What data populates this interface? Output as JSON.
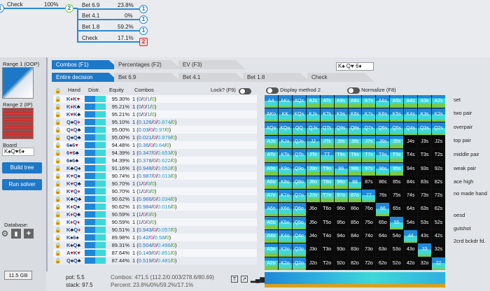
{
  "tree": {
    "root_node": "1",
    "check_label": "Check",
    "check_pct": "100%",
    "mid_node": "2",
    "actions": [
      {
        "label": "Bet 6.9",
        "pct": "23.8%",
        "node": "1"
      },
      {
        "label": "Bet 4.1",
        "pct": "0%",
        "node": "1"
      },
      {
        "label": "Bet 1.8",
        "pct": "59.2%",
        "node": "1"
      },
      {
        "label": "Check",
        "pct": "17.1%",
        "node": "2"
      }
    ]
  },
  "sidebar": {
    "range1": "Range 1 (OOP)",
    "range2": "Range 2 (IP)",
    "board_label": "Board",
    "board_cards": "K♠Q♥6♦",
    "build_tree": "Build tree",
    "run_solver": "Run solver",
    "database": "Database:",
    "memory": "11.5 GB"
  },
  "tabs": {
    "combos": "Combos (F1)",
    "percentages": "Percentages (F2)",
    "ev": "EV (F3)",
    "board_display": "K♠ Q♥ 6♦",
    "entire": "Entire decision",
    "bet69": "Bet 6.9",
    "bet41": "Bet 4.1",
    "bet18": "Bet 1.8",
    "check": "Check"
  },
  "table_header": {
    "hand": "Hand",
    "distr": "Distr.",
    "equity": "Equity",
    "combos": "Combos",
    "lock": "Lock? (F9)"
  },
  "rows": [
    {
      "hand": "K♦K♥",
      "equity": "95.30%",
      "combos": "1 (0/0/1/0)"
    },
    {
      "hand": "K♦K♣",
      "equity": "95.21%",
      "combos": "1 (0/0/1/0)"
    },
    {
      "hand": "K♥K♣",
      "equity": "95.21%",
      "combos": "1 (0/0/1/0)"
    },
    {
      "hand": "Q♠Q♦",
      "equity": "95.10%",
      "combos": "1 (0.126/0/0.874/0)"
    },
    {
      "hand": "Q♦Q♣",
      "equity": "95.00%",
      "combos": "1 (0.03/0/0.97/0)"
    },
    {
      "hand": "Q♠Q♣",
      "equity": "95.00%",
      "combos": "1 (0.021/0/0.979/0)"
    },
    {
      "hand": "6♠6♥",
      "equity": "94.48%",
      "combos": "1 (0.36/0/0.64/0)"
    },
    {
      "hand": "6♥6♣",
      "equity": "94.39%",
      "combos": "1 (0.347/0/0.653/0)"
    },
    {
      "hand": "6♠6♣",
      "equity": "94.39%",
      "combos": "1 (0.378/0/0.622/0)"
    },
    {
      "hand": "K♣Q♠",
      "equity": "91.16%",
      "combos": "1 (0.948/0/0.052/0)"
    },
    {
      "hand": "K♥Q♠",
      "equity": "90.74%",
      "combos": "1 (0.987/0/0.013/0)"
    },
    {
      "hand": "K♥Q♣",
      "equity": "90.70%",
      "combos": "1 (1/0/0/0)"
    },
    {
      "hand": "K♥Q♦",
      "equity": "90.70%",
      "combos": "1 (1/0/0/0)"
    },
    {
      "hand": "K♣Q♣",
      "equity": "90.62%",
      "combos": "1 (0.966/0/0.034/0)"
    },
    {
      "hand": "K♦Q♠",
      "equity": "90.62%",
      "combos": "1 (0.984/0/0.016/0)"
    },
    {
      "hand": "K♦Q♣",
      "equity": "90.59%",
      "combos": "1 (1/0/0/0)"
    },
    {
      "hand": "K♦Q♦",
      "equity": "90.59%",
      "combos": "1 (1/0/0/0)"
    },
    {
      "hand": "K♣Q♦",
      "equity": "90.51%",
      "combos": "1 (0.943/0/0.057/0)"
    },
    {
      "hand": "K♠6♠",
      "equity": "89.98%",
      "combos": "1 (0.42/0/0.58/0)"
    },
    {
      "hand": "K♠Q♣",
      "equity": "89.31%",
      "combos": "1 (0.504/0/0.496/0)"
    },
    {
      "hand": "A♥K♥",
      "equity": "87.64%",
      "combos": "1 (0.149/0/0.851/0)"
    },
    {
      "hand": "Q♠Q♣",
      "equity": "87.44%",
      "combos": "1 (0.519/0/0.481/0)"
    }
  ],
  "footer": {
    "pot": "pot: 5.5",
    "stack": "stack: 97.5",
    "combos": "Combos: 471.5 (112.2/0.003/278.6/80.69)",
    "percent": "Percent: 23.8%/0%/59.2%/17.1%"
  },
  "grid_controls": {
    "display_method": "Display method 2",
    "normalize": "Normalize (F8)"
  },
  "grid_labels": [
    [
      "AA",
      "AKs",
      "AQs",
      "AJs",
      "ATs",
      "A9s",
      "A8s",
      "A7s",
      "A6s",
      "A5s",
      "A4s",
      "A3s",
      "A2s"
    ],
    [
      "AKo",
      "KK",
      "KQs",
      "KJs",
      "KTs",
      "K9s",
      "K8s",
      "K7s",
      "K6s",
      "K5s",
      "K4s",
      "K3s",
      "K2s"
    ],
    [
      "AQo",
      "KQo",
      "QQ",
      "QJs",
      "QTs",
      "Q9s",
      "Q8s",
      "Q7s",
      "Q6s",
      "Q5s",
      "Q4s",
      "Q3s",
      "Q2s"
    ],
    [
      "AJo",
      "KJo",
      "QJo",
      "JJ",
      "JTs",
      "J9s",
      "J8s",
      "J7s",
      "J6s",
      "J5s",
      "J4s",
      "J3s",
      "J2s"
    ],
    [
      "ATo",
      "KTo",
      "QTo",
      "JTo",
      "TT",
      "T9s",
      "T8s",
      "T7s",
      "T6s",
      "T5s",
      "T4s",
      "T3s",
      "T2s"
    ],
    [
      "A9o",
      "K9o",
      "Q9o",
      "J9o",
      "T9o",
      "99",
      "98s",
      "97s",
      "96s",
      "95s",
      "94s",
      "93s",
      "92s"
    ],
    [
      "A8o",
      "K8o",
      "Q8o",
      "J8o",
      "T8o",
      "98o",
      "88",
      "87s",
      "86s",
      "85s",
      "84s",
      "83s",
      "82s"
    ],
    [
      "A7o",
      "K7o",
      "Q7o",
      "J7o",
      "T7o",
      "97o",
      "87o",
      "77",
      "76s",
      "75s",
      "74s",
      "73s",
      "72s"
    ],
    [
      "A6o",
      "K6o",
      "Q6o",
      "J6o",
      "T6o",
      "96o",
      "86o",
      "76o",
      "66",
      "65s",
      "64s",
      "63s",
      "62s"
    ],
    [
      "A5o",
      "K5o",
      "Q5o",
      "J5o",
      "T5o",
      "95o",
      "85o",
      "75o",
      "65o",
      "55",
      "54s",
      "53s",
      "52s"
    ],
    [
      "A4o",
      "K4o",
      "Q4o",
      "J4o",
      "T4o",
      "94o",
      "84o",
      "74o",
      "64o",
      "54o",
      "44",
      "43s",
      "42s"
    ],
    [
      "A3o",
      "K3o",
      "Q3o",
      "J3o",
      "T3o",
      "93o",
      "83o",
      "73o",
      "63o",
      "53o",
      "43o",
      "33",
      "32s"
    ],
    [
      "A2o",
      "K2o",
      "Q2o",
      "J2o",
      "T2o",
      "92o",
      "82o",
      "72o",
      "62o",
      "52o",
      "42o",
      "32o",
      "22"
    ]
  ],
  "legend": [
    "set",
    "two pair",
    "overpair",
    "top pair",
    "middle pair",
    "weak pair",
    "ace high",
    "no made hand",
    "oesd",
    "gutshot",
    "2crd bckdr fd."
  ],
  "colors": {
    "accent": "#1e78c8",
    "bet_big": "#1e88d8",
    "bet_small": "#3fd8d8",
    "check": "#7ac943",
    "empty": "#0a0a0a"
  }
}
